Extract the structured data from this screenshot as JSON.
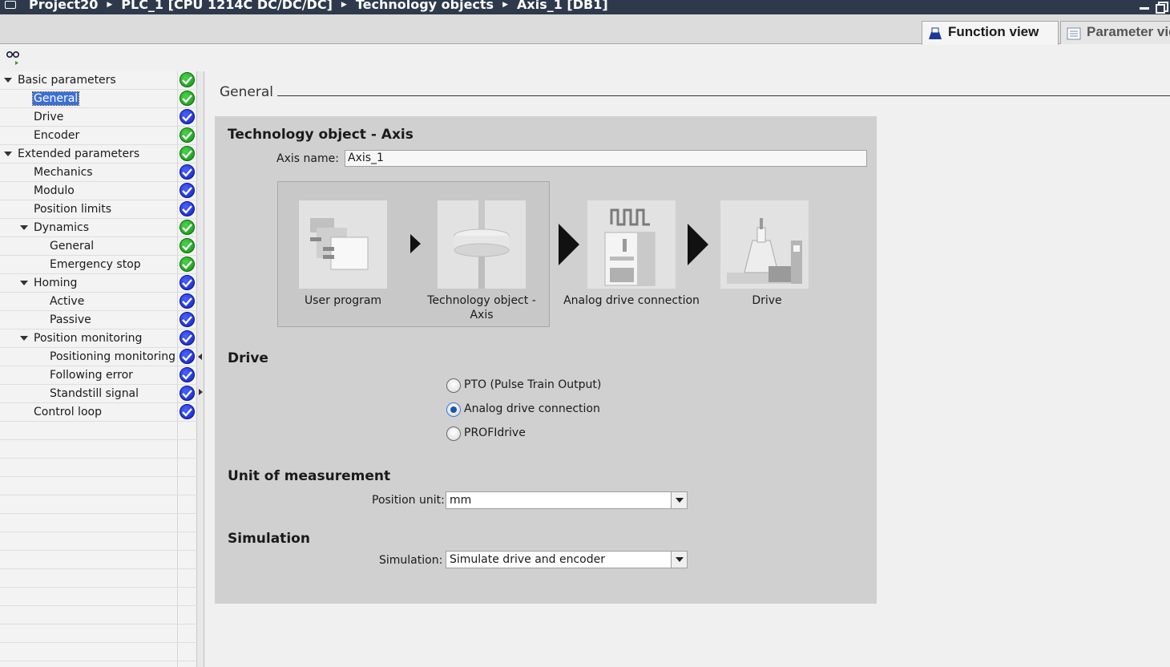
{
  "titlebar": {
    "breadcrumbs": [
      "Project20",
      "PLC_1 [CPU 1214C DC/DC/DC]",
      "Technology objects",
      "Axis_1 [DB1]"
    ]
  },
  "tabs": {
    "function_view": "Function view",
    "parameter_view": "Parameter view"
  },
  "tree": {
    "items": [
      {
        "label": "Basic parameters",
        "status": "green"
      },
      {
        "label": "General",
        "status": "green"
      },
      {
        "label": "Drive",
        "status": "blue"
      },
      {
        "label": "Encoder",
        "status": "green"
      },
      {
        "label": "Extended parameters",
        "status": "green"
      },
      {
        "label": "Mechanics",
        "status": "blue"
      },
      {
        "label": "Modulo",
        "status": "blue"
      },
      {
        "label": "Position limits",
        "status": "blue"
      },
      {
        "label": "Dynamics",
        "status": "green"
      },
      {
        "label": "General",
        "status": "green"
      },
      {
        "label": "Emergency stop",
        "status": "green"
      },
      {
        "label": "Homing",
        "status": "blue"
      },
      {
        "label": "Active",
        "status": "blue"
      },
      {
        "label": "Passive",
        "status": "blue"
      },
      {
        "label": "Position monitoring",
        "status": "blue"
      },
      {
        "label": "Positioning monitoring",
        "status": "blue"
      },
      {
        "label": "Following error",
        "status": "blue"
      },
      {
        "label": "Standstill signal",
        "status": "blue"
      },
      {
        "label": "Control loop",
        "status": "blue"
      }
    ]
  },
  "main": {
    "section_title": "General",
    "panel_title": "Technology object - Axis",
    "axis_name_label": "Axis name:",
    "axis_name_value": "Axis_1",
    "diagram": {
      "user_program": "User program",
      "technology_object_line1": "Technology object -",
      "technology_object_line2": "Axis",
      "analog_drive_connection": "Analog drive connection",
      "drive": "Drive"
    },
    "drive_heading": "Drive",
    "drive_options": [
      "PTO (Pulse Train Output)",
      "Analog drive connection",
      "PROFIdrive"
    ],
    "drive_selected": "Analog drive connection",
    "unit_heading": "Unit of measurement",
    "position_unit_label": "Position unit:",
    "position_unit_value": "mm",
    "simulation_heading": "Simulation",
    "simulation_label": "Simulation:",
    "simulation_value": "Simulate drive and encoder"
  },
  "colors": {
    "titlebar": "#2e3a4c",
    "status_green": "#139013",
    "status_blue": "#1020c8",
    "selection": "#3a6fd8",
    "panel": "#d0d0d0"
  }
}
